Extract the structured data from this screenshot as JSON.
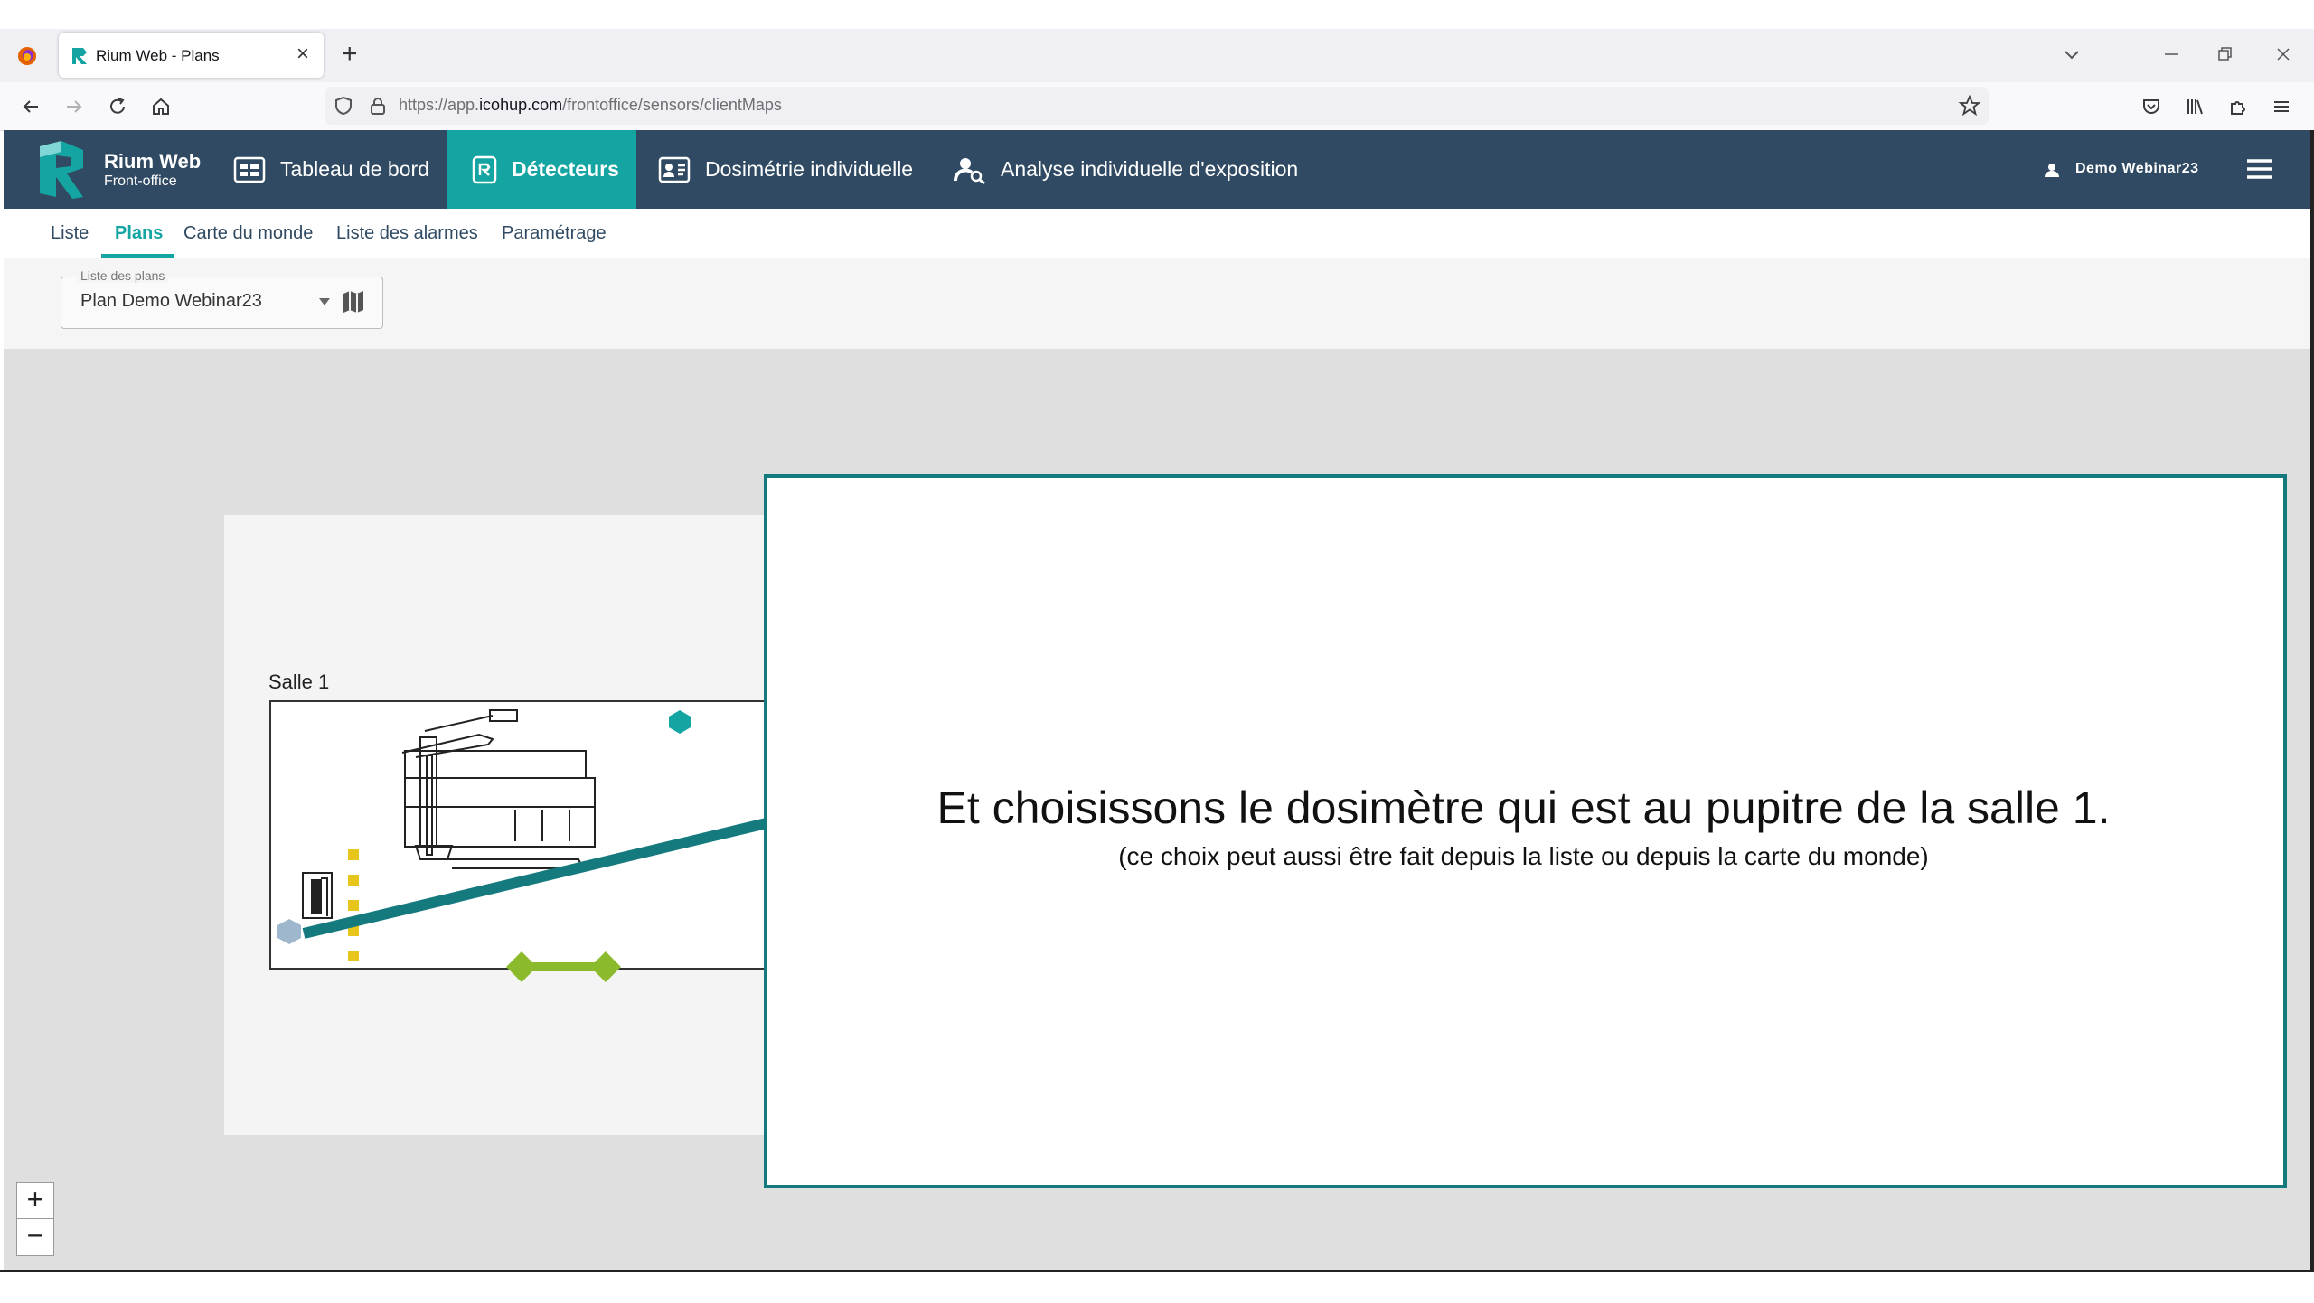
{
  "browser": {
    "tab_title": "Rium Web - Plans",
    "tab_close": "×",
    "new_tab": "+",
    "url_prefix": "https://app.",
    "url_domain": "icohup.com",
    "url_path": "/frontoffice/sensors/clientMaps"
  },
  "app": {
    "brand_title": "Rium Web",
    "brand_subtitle": "Front-office",
    "nav": [
      {
        "label": "Tableau de bord",
        "icon": "dashboard-icon"
      },
      {
        "label": "Détecteurs",
        "icon": "detector-icon",
        "active": true
      },
      {
        "label": "Dosimétrie individuelle",
        "icon": "id-card-icon"
      },
      {
        "label": "Analyse individuelle d'exposition",
        "icon": "person-search-icon"
      }
    ],
    "user": "Demo Webinar23",
    "accent_color": "#14a5a3",
    "header_color": "#2f4a62"
  },
  "subnav": [
    {
      "label": "Liste"
    },
    {
      "label": "Plans",
      "active": true
    },
    {
      "label": "Carte du monde"
    },
    {
      "label": "Liste des alarmes"
    },
    {
      "label": "Paramétrage"
    }
  ],
  "plan_select": {
    "label": "Liste des plans",
    "value": "Plan Demo Webinar23"
  },
  "map": {
    "room_label": "Salle 1",
    "zoom_in": "+",
    "zoom_out": "−"
  },
  "annotation": {
    "main": "Et choisissons le dosimètre qui est au pupitre de la salle 1.",
    "sub": "(ce choix peut aussi être fait depuis la liste ou depuis la carte du monde)",
    "border_color": "#157a7d"
  }
}
